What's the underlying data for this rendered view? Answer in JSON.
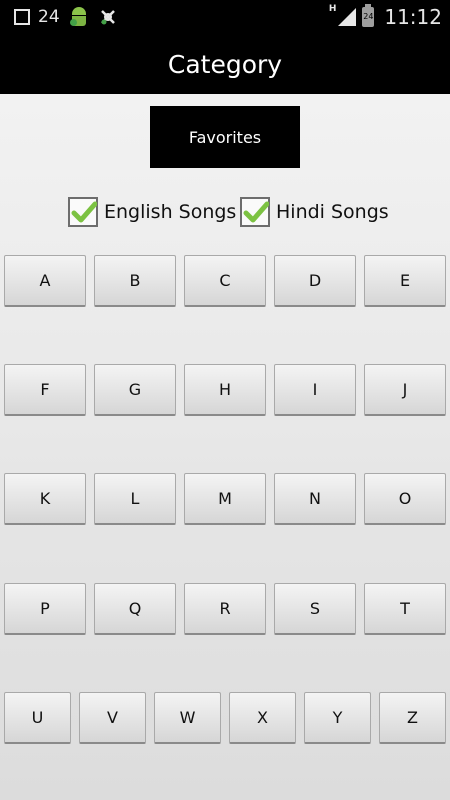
{
  "status_bar": {
    "notification_count": "24",
    "network_label": "H",
    "battery_level": "24",
    "time": "11:12",
    "icons": [
      "square-icon",
      "android-icon",
      "bluetooth-icon",
      "signal-icon",
      "battery-icon"
    ]
  },
  "header": {
    "title": "Category"
  },
  "favorites_label": "Favorites",
  "filters": [
    {
      "label": "English Songs",
      "checked": true
    },
    {
      "label": "Hindi Songs",
      "checked": true
    }
  ],
  "letter_rows": [
    [
      "A",
      "B",
      "C",
      "D",
      "E"
    ],
    [
      "F",
      "G",
      "H",
      "I",
      "J"
    ],
    [
      "K",
      "L",
      "M",
      "N",
      "O"
    ],
    [
      "P",
      "Q",
      "R",
      "S",
      "T"
    ],
    [
      "U",
      "V",
      "W",
      "X",
      "Y",
      "Z"
    ]
  ],
  "colors": {
    "bar_background": "#000000",
    "checkmark": "#7cc242"
  }
}
